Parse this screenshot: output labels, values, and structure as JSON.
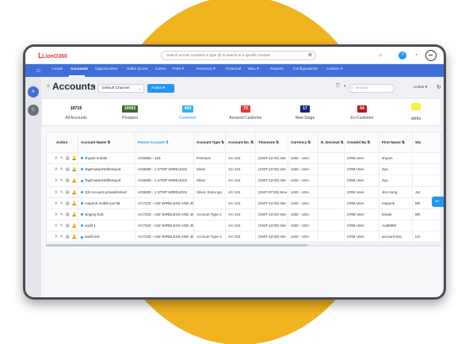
{
  "app": {
    "logo_text": "LionO360"
  },
  "topbar": {
    "search_placeholder": "Search across modules or type @ to search in a specific module",
    "icons": [
      "gear-icon",
      "home-icon",
      "help-icon",
      "notification-icon",
      "user-avatar-icon"
    ]
  },
  "nav": {
    "items": [
      "Leads",
      "Accounts",
      "Opportunities",
      "Sales Quota",
      "Cases",
      "FSM ▾",
      "Inventory ▾",
      "Financial",
      "Misc ▾",
      "Reports",
      "Configurations",
      "Custom ▾"
    ]
  },
  "sidebar": {
    "buttons": [
      "A",
      "C"
    ]
  },
  "header": {
    "title": "Accounts",
    "view_select": "Default Channel",
    "action_button": "Action ▾",
    "search_placeholder": "Search",
    "action_dropdown": "Action ▾"
  },
  "stats": [
    {
      "value": "10715",
      "label": "All Accounts",
      "bg": "#ffffff",
      "fg": "#111111"
    },
    {
      "value": "10092",
      "label": "Prospect",
      "bg": "#3d6b2a",
      "fg": "#ffffff"
    },
    {
      "value": "465",
      "label": "Customer",
      "bg": "#29b6f6",
      "fg": "#ffffff"
    },
    {
      "value": "72",
      "label": "Assured Customer",
      "bg": "#e53935",
      "fg": "#ffffff"
    },
    {
      "value": "17",
      "label": "New Stage",
      "bg": "#1a237e",
      "fg": "#ffffff"
    },
    {
      "value": "54",
      "label": "Ex-Customer",
      "bg": "#b71c1c",
      "fg": "#ffffff"
    },
    {
      "value": "",
      "label": "dsfda",
      "bg": "#f5f53a",
      "fg": "#111111"
    }
  ],
  "table": {
    "columns": [
      "Action",
      "Account Name ⇅",
      "Parent Account ⇅",
      "Account Type ⇅",
      "Account No. ⇅",
      "Timezone ⇅",
      "Currency ⇅",
      "N_Decimal ⇅",
      "Created By ⇅",
      "First Name ⇅",
      "Sta"
    ],
    "rows": [
      [
        "shyam mobile",
        "AG5659 - 123",
        "Premium",
        "AC-101",
        "(GMT-12:00) Inte",
        "USD - USA",
        "",
        "CRM User",
        "shyam",
        ""
      ],
      [
        "TagFeatureWithImport",
        "AG5830 - 1 STOP WIRELESS",
        "Silver",
        "AC-101",
        "(GMT-12:00) Inte",
        "USD - USA",
        "",
        "CRM User",
        "Zya",
        ""
      ],
      [
        "TagFeatureWithImport",
        "AG5830 - 1 STOP WIRELESS",
        "Silver",
        "AC-101",
        "(GMT-12:00) Inte",
        "USD - USA",
        "",
        "CRM User",
        "Zya",
        ""
      ],
      [
        "QS Account privatelimited",
        "AG5830 - 1 STOP WIRELESS",
        "Silver, Extra typ",
        "AC-101",
        "(GMT-07:00) Mou",
        "USD - USA",
        "",
        "CRM User",
        "Jim Hong",
        "Jar"
      ],
      [
        "mayank mobile pvt ltd",
        "AC7233 - A2Z WIRELESS AND JEW",
        "",
        "AC-101",
        "(GMT-12:00) Inte",
        "USD - USA",
        "",
        "CRM User",
        "mayank",
        "6th"
      ],
      [
        "singing hub",
        "AC7233 - A2Z WIRELESS AND JEW",
        "Account Type o",
        "AC-101",
        "(GMT-12:00) Inte",
        "USD - USA",
        "",
        "CRM User",
        "kanak",
        "6th"
      ],
      [
        "audit 1",
        "AC7233 - A2Z WIRELESS AND JEW",
        "",
        "AC-101",
        "(GMT-12:00) Inte",
        "USD - USA",
        "",
        "CRM User",
        "Audit990",
        ""
      ],
      [
        "audit test",
        "AC7233 - A2Z WIRELESS AND JEW",
        "Account Type o",
        "AC-101",
        "(GMT-12:00) Inte",
        "USD - USA",
        "",
        "CRM User",
        "account test",
        "US"
      ]
    ]
  },
  "colors": {
    "accent": "#3f6fd6",
    "link": "#2196f3",
    "backdrop_circle": "#f0b41e",
    "device_frame": "#4a4d55"
  }
}
